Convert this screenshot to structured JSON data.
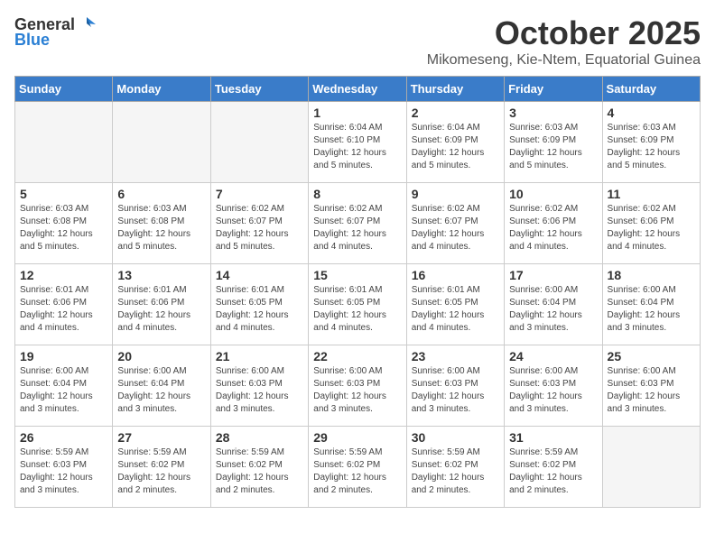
{
  "header": {
    "logo_general": "General",
    "logo_blue": "Blue",
    "month": "October 2025",
    "location": "Mikomeseng, Kie-Ntem, Equatorial Guinea"
  },
  "days_of_week": [
    "Sunday",
    "Monday",
    "Tuesday",
    "Wednesday",
    "Thursday",
    "Friday",
    "Saturday"
  ],
  "weeks": [
    [
      {
        "day": "",
        "info": ""
      },
      {
        "day": "",
        "info": ""
      },
      {
        "day": "",
        "info": ""
      },
      {
        "day": "1",
        "info": "Sunrise: 6:04 AM\nSunset: 6:10 PM\nDaylight: 12 hours\nand 5 minutes."
      },
      {
        "day": "2",
        "info": "Sunrise: 6:04 AM\nSunset: 6:09 PM\nDaylight: 12 hours\nand 5 minutes."
      },
      {
        "day": "3",
        "info": "Sunrise: 6:03 AM\nSunset: 6:09 PM\nDaylight: 12 hours\nand 5 minutes."
      },
      {
        "day": "4",
        "info": "Sunrise: 6:03 AM\nSunset: 6:09 PM\nDaylight: 12 hours\nand 5 minutes."
      }
    ],
    [
      {
        "day": "5",
        "info": "Sunrise: 6:03 AM\nSunset: 6:08 PM\nDaylight: 12 hours\nand 5 minutes."
      },
      {
        "day": "6",
        "info": "Sunrise: 6:03 AM\nSunset: 6:08 PM\nDaylight: 12 hours\nand 5 minutes."
      },
      {
        "day": "7",
        "info": "Sunrise: 6:02 AM\nSunset: 6:07 PM\nDaylight: 12 hours\nand 5 minutes."
      },
      {
        "day": "8",
        "info": "Sunrise: 6:02 AM\nSunset: 6:07 PM\nDaylight: 12 hours\nand 4 minutes."
      },
      {
        "day": "9",
        "info": "Sunrise: 6:02 AM\nSunset: 6:07 PM\nDaylight: 12 hours\nand 4 minutes."
      },
      {
        "day": "10",
        "info": "Sunrise: 6:02 AM\nSunset: 6:06 PM\nDaylight: 12 hours\nand 4 minutes."
      },
      {
        "day": "11",
        "info": "Sunrise: 6:02 AM\nSunset: 6:06 PM\nDaylight: 12 hours\nand 4 minutes."
      }
    ],
    [
      {
        "day": "12",
        "info": "Sunrise: 6:01 AM\nSunset: 6:06 PM\nDaylight: 12 hours\nand 4 minutes."
      },
      {
        "day": "13",
        "info": "Sunrise: 6:01 AM\nSunset: 6:06 PM\nDaylight: 12 hours\nand 4 minutes."
      },
      {
        "day": "14",
        "info": "Sunrise: 6:01 AM\nSunset: 6:05 PM\nDaylight: 12 hours\nand 4 minutes."
      },
      {
        "day": "15",
        "info": "Sunrise: 6:01 AM\nSunset: 6:05 PM\nDaylight: 12 hours\nand 4 minutes."
      },
      {
        "day": "16",
        "info": "Sunrise: 6:01 AM\nSunset: 6:05 PM\nDaylight: 12 hours\nand 4 minutes."
      },
      {
        "day": "17",
        "info": "Sunrise: 6:00 AM\nSunset: 6:04 PM\nDaylight: 12 hours\nand 3 minutes."
      },
      {
        "day": "18",
        "info": "Sunrise: 6:00 AM\nSunset: 6:04 PM\nDaylight: 12 hours\nand 3 minutes."
      }
    ],
    [
      {
        "day": "19",
        "info": "Sunrise: 6:00 AM\nSunset: 6:04 PM\nDaylight: 12 hours\nand 3 minutes."
      },
      {
        "day": "20",
        "info": "Sunrise: 6:00 AM\nSunset: 6:04 PM\nDaylight: 12 hours\nand 3 minutes."
      },
      {
        "day": "21",
        "info": "Sunrise: 6:00 AM\nSunset: 6:03 PM\nDaylight: 12 hours\nand 3 minutes."
      },
      {
        "day": "22",
        "info": "Sunrise: 6:00 AM\nSunset: 6:03 PM\nDaylight: 12 hours\nand 3 minutes."
      },
      {
        "day": "23",
        "info": "Sunrise: 6:00 AM\nSunset: 6:03 PM\nDaylight: 12 hours\nand 3 minutes."
      },
      {
        "day": "24",
        "info": "Sunrise: 6:00 AM\nSunset: 6:03 PM\nDaylight: 12 hours\nand 3 minutes."
      },
      {
        "day": "25",
        "info": "Sunrise: 6:00 AM\nSunset: 6:03 PM\nDaylight: 12 hours\nand 3 minutes."
      }
    ],
    [
      {
        "day": "26",
        "info": "Sunrise: 5:59 AM\nSunset: 6:03 PM\nDaylight: 12 hours\nand 3 minutes."
      },
      {
        "day": "27",
        "info": "Sunrise: 5:59 AM\nSunset: 6:02 PM\nDaylight: 12 hours\nand 2 minutes."
      },
      {
        "day": "28",
        "info": "Sunrise: 5:59 AM\nSunset: 6:02 PM\nDaylight: 12 hours\nand 2 minutes."
      },
      {
        "day": "29",
        "info": "Sunrise: 5:59 AM\nSunset: 6:02 PM\nDaylight: 12 hours\nand 2 minutes."
      },
      {
        "day": "30",
        "info": "Sunrise: 5:59 AM\nSunset: 6:02 PM\nDaylight: 12 hours\nand 2 minutes."
      },
      {
        "day": "31",
        "info": "Sunrise: 5:59 AM\nSunset: 6:02 PM\nDaylight: 12 hours\nand 2 minutes."
      },
      {
        "day": "",
        "info": ""
      }
    ]
  ]
}
